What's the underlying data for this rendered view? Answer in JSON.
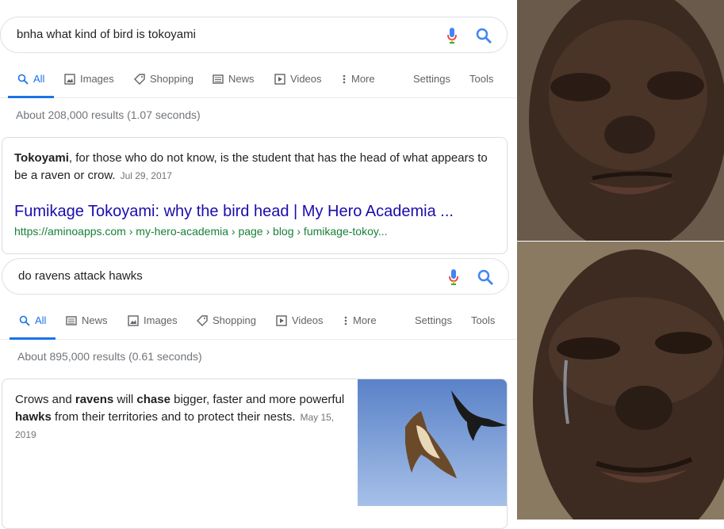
{
  "top": {
    "query": "bnha what kind of bird is tokoyami",
    "tabs": [
      "All",
      "Images",
      "Shopping",
      "News",
      "Videos",
      "More"
    ],
    "settings": "Settings",
    "tools": "Tools",
    "stats": "About 208,000 results (1.07 seconds)",
    "snippet_bold": "Tokoyami",
    "snippet_rest": ", for those who do not know, is the student that has the head of what appears to be a raven or crow.",
    "snippet_date": "Jul 29, 2017",
    "result_title": "Fumikage Tokoyami: why the bird head | My Hero Academia ...",
    "result_url": "https://aminoapps.com › my-hero-academia › page › blog › fumikage-tokoy..."
  },
  "bottom": {
    "query": "do ravens attack hawks",
    "tabs": [
      "All",
      "News",
      "Images",
      "Shopping",
      "Videos",
      "More"
    ],
    "settings": "Settings",
    "tools": "Tools",
    "stats": "About 895,000 results (0.61 seconds)",
    "s1": "Crows and ",
    "s2": "ravens",
    "s3": " will ",
    "s4": "chase",
    "s5": " bigger, faster and more powerful ",
    "s6": "hawks",
    "s7": " from their territories and to protect their nests.",
    "snippet_date": "May 15, 2019"
  },
  "colors": {
    "link": "#1a0dab",
    "url": "#188038",
    "accent": "#1a73e8",
    "sky": "#6b8fd0"
  }
}
